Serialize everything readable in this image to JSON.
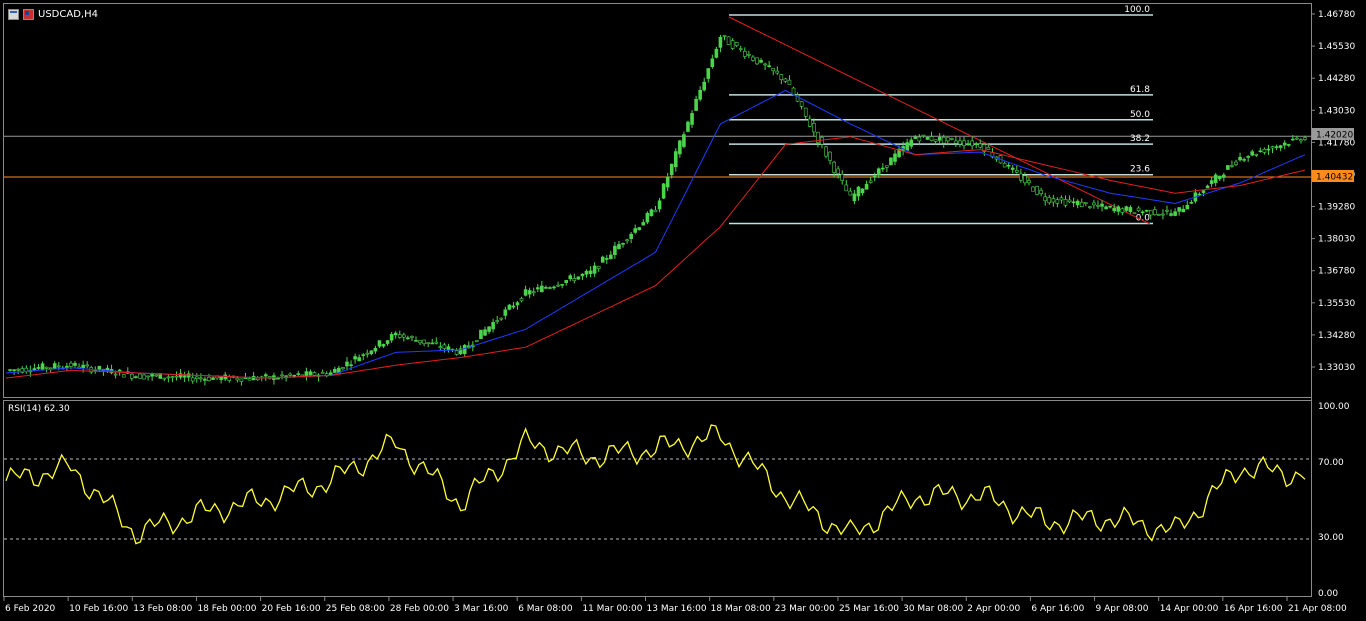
{
  "header": {
    "symbol_label": "USDCAD,H4",
    "icon_left": "chart-window-icon",
    "icon_right": "flag-icon"
  },
  "rsi": {
    "label": "RSI(14) 62.30",
    "levels": [
      70,
      30
    ],
    "ticks": [
      "100.00",
      "70.00",
      "30.00",
      "0.00"
    ]
  },
  "price_axis": {
    "ticks": [
      "1.46780",
      "1.45530",
      "1.44280",
      "1.43030",
      "1.41780",
      "1.40530",
      "1.39280",
      "1.38030",
      "1.36780",
      "1.35530",
      "1.34280",
      "1.33030"
    ],
    "current_price": "1.42020",
    "hline_price": "1.40432"
  },
  "time_axis": {
    "labels": [
      "6 Feb 2020",
      "10 Feb 16:00",
      "13 Feb 08:00",
      "18 Feb 00:00",
      "20 Feb 16:00",
      "25 Feb 08:00",
      "28 Feb 00:00",
      "3 Mar 16:00",
      "6 Mar 08:00",
      "11 Mar 00:00",
      "13 Mar 16:00",
      "18 Mar 08:00",
      "23 Mar 00:00",
      "25 Mar 16:00",
      "30 Mar 08:00",
      "2 Apr 00:00",
      "6 Apr 16:00",
      "9 Apr 08:00",
      "14 Apr 00:00",
      "16 Apr 16:00",
      "21 Apr 08:00"
    ]
  },
  "fibonacci": {
    "levels": [
      "100.0",
      "61.8",
      "50.0",
      "38.2",
      "23.6",
      "0.0"
    ]
  },
  "colors": {
    "background": "#000000",
    "candles": "#4cd44c",
    "ma_fast": "#1e3cff",
    "ma_slow": "#e02020",
    "rsi_line": "#ffff33",
    "fib_lines": "#bfe0e0",
    "hline": "#ff8c1a"
  },
  "chart_data": {
    "type": "line",
    "title": "USDCAD,H4",
    "xlabel": "",
    "ylabel": "",
    "ylim": [
      1.3228,
      1.4706
    ],
    "x": [
      "6 Feb 2020",
      "10 Feb 16:00",
      "13 Feb 08:00",
      "18 Feb 00:00",
      "20 Feb 16:00",
      "25 Feb 08:00",
      "28 Feb 00:00",
      "3 Mar 16:00",
      "6 Mar 08:00",
      "11 Mar 00:00",
      "13 Mar 16:00",
      "18 Mar 08:00",
      "23 Mar 00:00",
      "25 Mar 16:00",
      "30 Mar 08:00",
      "2 Apr 00:00",
      "6 Apr 16:00",
      "9 Apr 08:00",
      "14 Apr 00:00",
      "16 Apr 16:00",
      "21 Apr 08:00"
    ],
    "series": [
      {
        "values": [
          1.329,
          1.331,
          1.327,
          1.326,
          1.326,
          1.328,
          1.343,
          1.336,
          1.359,
          1.367,
          1.392,
          1.459,
          1.442,
          1.396,
          1.42,
          1.417,
          1.396,
          1.392,
          1.39,
          1.412,
          1.42
        ]
      },
      {
        "values": [
          1.328,
          1.33,
          1.328,
          1.327,
          1.326,
          1.327,
          1.336,
          1.337,
          1.345,
          1.36,
          1.375,
          1.425,
          1.438,
          1.425,
          1.413,
          1.414,
          1.405,
          1.398,
          1.394,
          1.402,
          1.413
        ]
      },
      {
        "values": [
          1.326,
          1.329,
          1.328,
          1.327,
          1.326,
          1.327,
          1.331,
          1.334,
          1.338,
          1.35,
          1.362,
          1.385,
          1.417,
          1.42,
          1.413,
          1.415,
          1.409,
          1.403,
          1.398,
          1.401,
          1.407
        ]
      }
    ],
    "rsi_values": [
      60,
      67,
      32,
      43,
      50,
      60,
      80,
      48,
      80,
      73,
      77,
      84,
      52,
      31,
      52,
      52,
      38,
      40,
      33,
      67,
      63
    ],
    "fib_levels": [
      {
        "label": "100.0",
        "price": 1.4674
      },
      {
        "label": "61.8",
        "price": 1.4363
      },
      {
        "label": "50.0",
        "price": 1.4266
      },
      {
        "label": "38.2",
        "price": 1.4171
      },
      {
        "label": "23.6",
        "price": 1.4052
      },
      {
        "label": "0.0",
        "price": 1.3862
      }
    ],
    "grid": false,
    "legend": "none"
  }
}
